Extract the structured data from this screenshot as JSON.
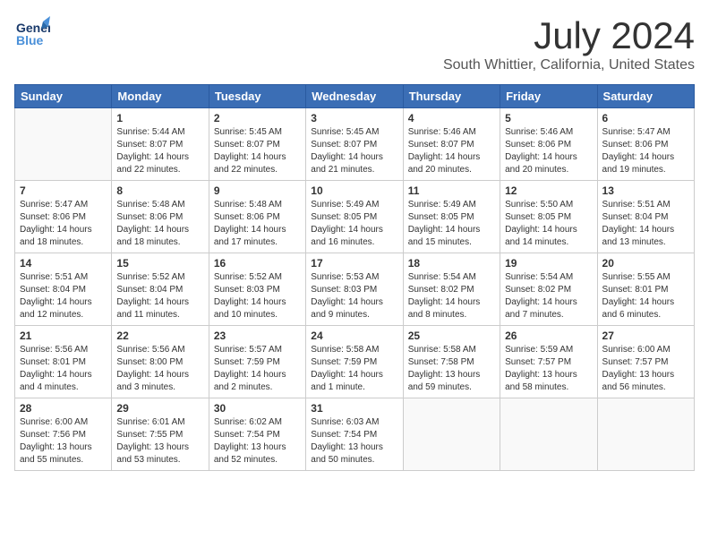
{
  "header": {
    "logo_general": "General",
    "logo_blue": "Blue",
    "month": "July 2024",
    "location": "South Whittier, California, United States"
  },
  "days_of_week": [
    "Sunday",
    "Monday",
    "Tuesday",
    "Wednesday",
    "Thursday",
    "Friday",
    "Saturday"
  ],
  "weeks": [
    [
      {
        "day": "",
        "info": ""
      },
      {
        "day": "1",
        "info": "Sunrise: 5:44 AM\nSunset: 8:07 PM\nDaylight: 14 hours\nand 22 minutes."
      },
      {
        "day": "2",
        "info": "Sunrise: 5:45 AM\nSunset: 8:07 PM\nDaylight: 14 hours\nand 22 minutes."
      },
      {
        "day": "3",
        "info": "Sunrise: 5:45 AM\nSunset: 8:07 PM\nDaylight: 14 hours\nand 21 minutes."
      },
      {
        "day": "4",
        "info": "Sunrise: 5:46 AM\nSunset: 8:07 PM\nDaylight: 14 hours\nand 20 minutes."
      },
      {
        "day": "5",
        "info": "Sunrise: 5:46 AM\nSunset: 8:06 PM\nDaylight: 14 hours\nand 20 minutes."
      },
      {
        "day": "6",
        "info": "Sunrise: 5:47 AM\nSunset: 8:06 PM\nDaylight: 14 hours\nand 19 minutes."
      }
    ],
    [
      {
        "day": "7",
        "info": "Sunrise: 5:47 AM\nSunset: 8:06 PM\nDaylight: 14 hours\nand 18 minutes."
      },
      {
        "day": "8",
        "info": "Sunrise: 5:48 AM\nSunset: 8:06 PM\nDaylight: 14 hours\nand 18 minutes."
      },
      {
        "day": "9",
        "info": "Sunrise: 5:48 AM\nSunset: 8:06 PM\nDaylight: 14 hours\nand 17 minutes."
      },
      {
        "day": "10",
        "info": "Sunrise: 5:49 AM\nSunset: 8:05 PM\nDaylight: 14 hours\nand 16 minutes."
      },
      {
        "day": "11",
        "info": "Sunrise: 5:49 AM\nSunset: 8:05 PM\nDaylight: 14 hours\nand 15 minutes."
      },
      {
        "day": "12",
        "info": "Sunrise: 5:50 AM\nSunset: 8:05 PM\nDaylight: 14 hours\nand 14 minutes."
      },
      {
        "day": "13",
        "info": "Sunrise: 5:51 AM\nSunset: 8:04 PM\nDaylight: 14 hours\nand 13 minutes."
      }
    ],
    [
      {
        "day": "14",
        "info": "Sunrise: 5:51 AM\nSunset: 8:04 PM\nDaylight: 14 hours\nand 12 minutes."
      },
      {
        "day": "15",
        "info": "Sunrise: 5:52 AM\nSunset: 8:04 PM\nDaylight: 14 hours\nand 11 minutes."
      },
      {
        "day": "16",
        "info": "Sunrise: 5:52 AM\nSunset: 8:03 PM\nDaylight: 14 hours\nand 10 minutes."
      },
      {
        "day": "17",
        "info": "Sunrise: 5:53 AM\nSunset: 8:03 PM\nDaylight: 14 hours\nand 9 minutes."
      },
      {
        "day": "18",
        "info": "Sunrise: 5:54 AM\nSunset: 8:02 PM\nDaylight: 14 hours\nand 8 minutes."
      },
      {
        "day": "19",
        "info": "Sunrise: 5:54 AM\nSunset: 8:02 PM\nDaylight: 14 hours\nand 7 minutes."
      },
      {
        "day": "20",
        "info": "Sunrise: 5:55 AM\nSunset: 8:01 PM\nDaylight: 14 hours\nand 6 minutes."
      }
    ],
    [
      {
        "day": "21",
        "info": "Sunrise: 5:56 AM\nSunset: 8:01 PM\nDaylight: 14 hours\nand 4 minutes."
      },
      {
        "day": "22",
        "info": "Sunrise: 5:56 AM\nSunset: 8:00 PM\nDaylight: 14 hours\nand 3 minutes."
      },
      {
        "day": "23",
        "info": "Sunrise: 5:57 AM\nSunset: 7:59 PM\nDaylight: 14 hours\nand 2 minutes."
      },
      {
        "day": "24",
        "info": "Sunrise: 5:58 AM\nSunset: 7:59 PM\nDaylight: 14 hours\nand 1 minute."
      },
      {
        "day": "25",
        "info": "Sunrise: 5:58 AM\nSunset: 7:58 PM\nDaylight: 13 hours\nand 59 minutes."
      },
      {
        "day": "26",
        "info": "Sunrise: 5:59 AM\nSunset: 7:57 PM\nDaylight: 13 hours\nand 58 minutes."
      },
      {
        "day": "27",
        "info": "Sunrise: 6:00 AM\nSunset: 7:57 PM\nDaylight: 13 hours\nand 56 minutes."
      }
    ],
    [
      {
        "day": "28",
        "info": "Sunrise: 6:00 AM\nSunset: 7:56 PM\nDaylight: 13 hours\nand 55 minutes."
      },
      {
        "day": "29",
        "info": "Sunrise: 6:01 AM\nSunset: 7:55 PM\nDaylight: 13 hours\nand 53 minutes."
      },
      {
        "day": "30",
        "info": "Sunrise: 6:02 AM\nSunset: 7:54 PM\nDaylight: 13 hours\nand 52 minutes."
      },
      {
        "day": "31",
        "info": "Sunrise: 6:03 AM\nSunset: 7:54 PM\nDaylight: 13 hours\nand 50 minutes."
      },
      {
        "day": "",
        "info": ""
      },
      {
        "day": "",
        "info": ""
      },
      {
        "day": "",
        "info": ""
      }
    ]
  ]
}
